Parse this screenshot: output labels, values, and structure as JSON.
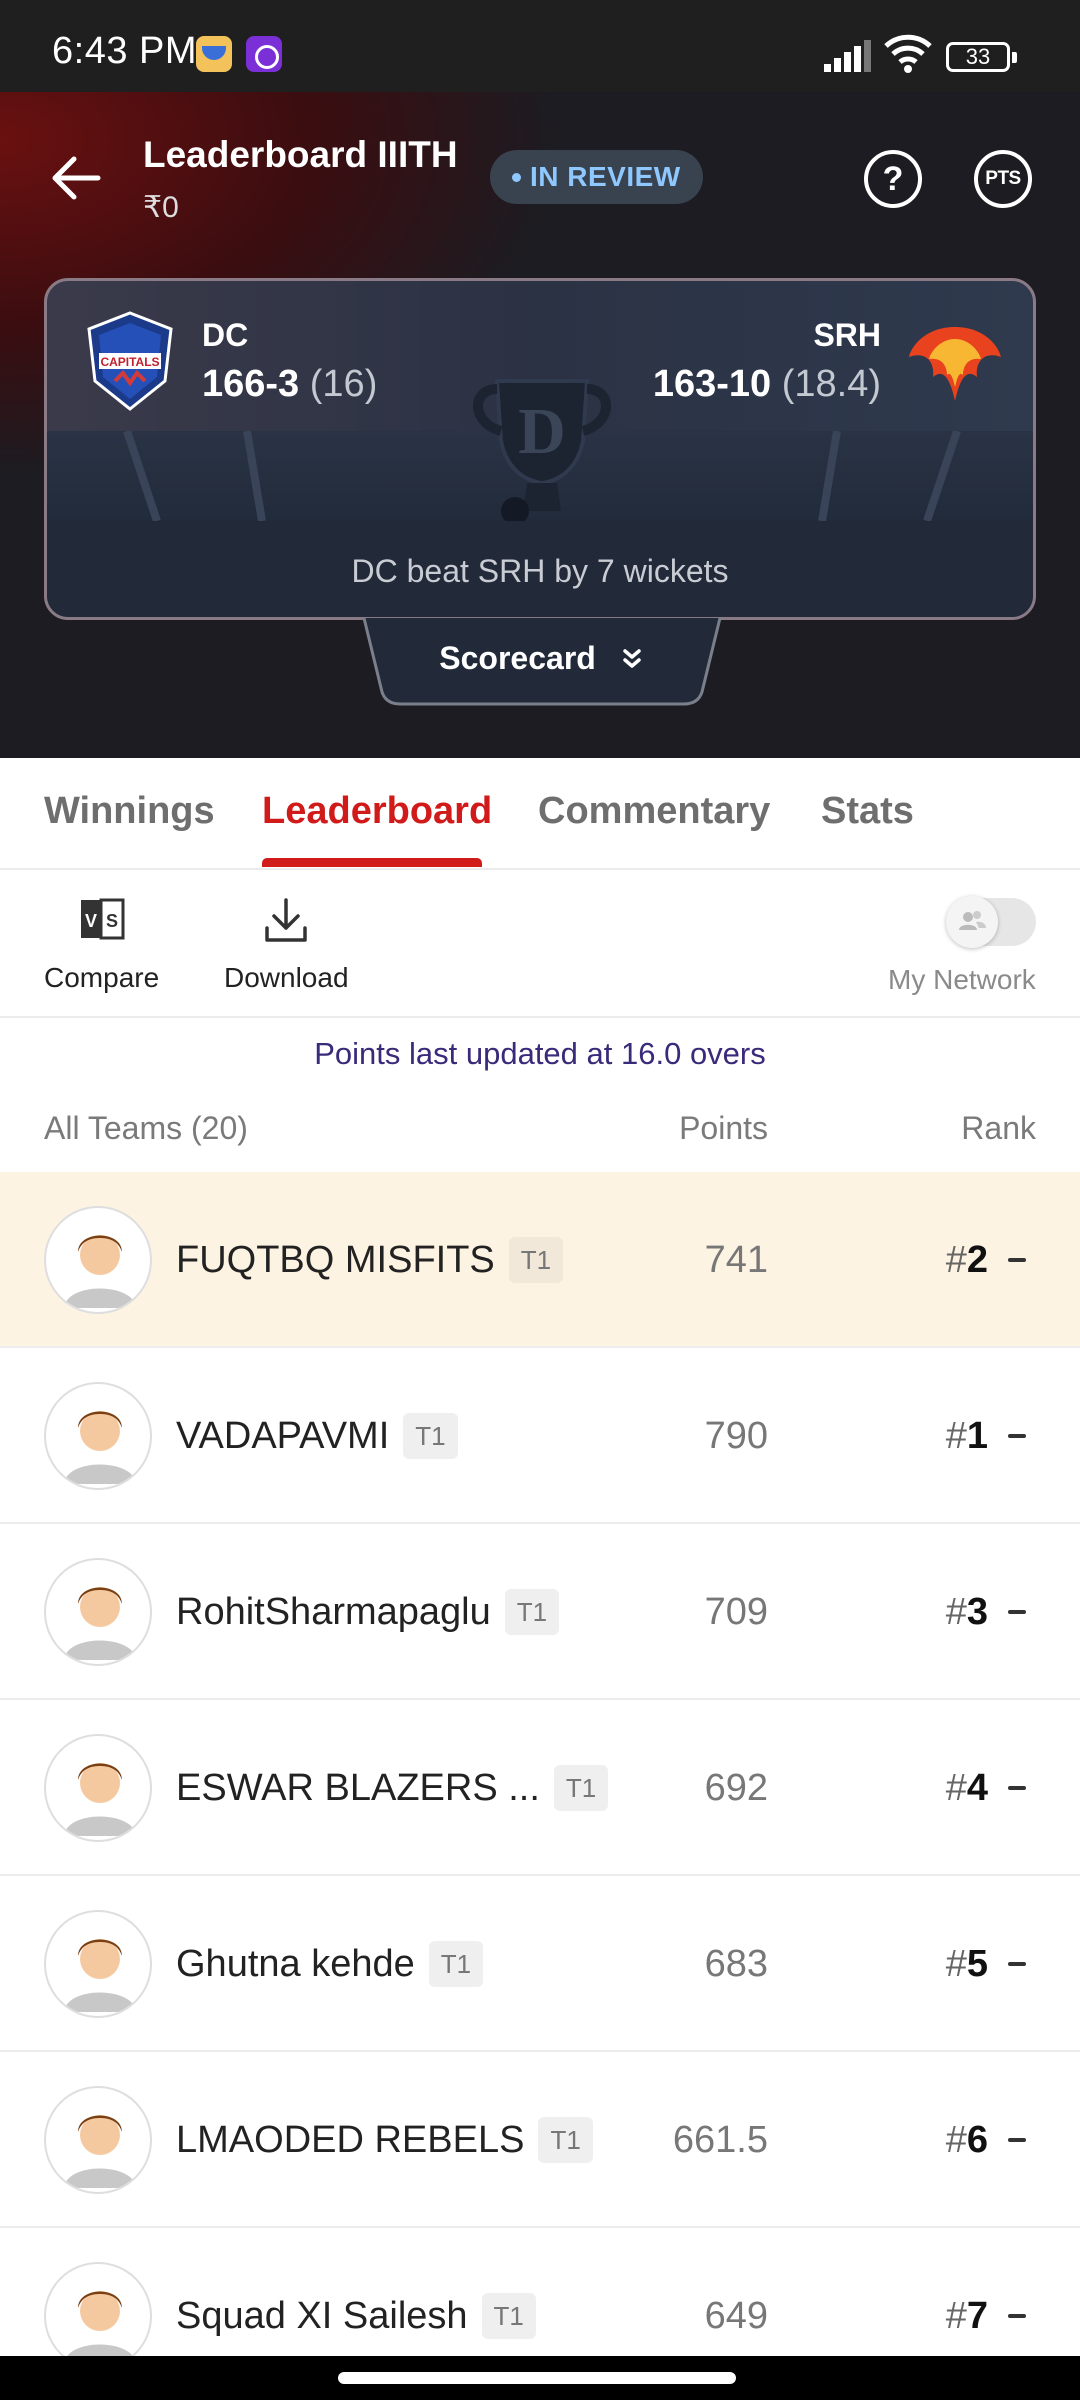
{
  "status_bar": {
    "time": "6:43 PM",
    "battery": "33"
  },
  "header": {
    "title": "Leaderboard IIITH",
    "amount": "₹0",
    "badge": "IN REVIEW",
    "help_icon": "question-circle-icon",
    "points_button": "PTS"
  },
  "match": {
    "team_left": {
      "name": "DC",
      "score": "166-3",
      "overs": "(16)",
      "logo": "delhi-capitals-logo"
    },
    "team_right": {
      "name": "SRH",
      "score": "163-10",
      "overs": "(18.4)",
      "logo": "sunrisers-logo"
    },
    "result": "DC beat SRH by 7 wickets",
    "scorecard_label": "Scorecard"
  },
  "tabs": [
    "Winnings",
    "Leaderboard",
    "Commentary",
    "Stats"
  ],
  "active_tab": "Leaderboard",
  "toolbar": {
    "compare_label": "Compare",
    "download_label": "Download",
    "network_label": "My Network",
    "network_enabled": false
  },
  "updated_note": "Points last updated at 16.0 overs",
  "list_header": {
    "teams": "All Teams (20)",
    "points": "Points",
    "rank": "Rank"
  },
  "rows": [
    {
      "name": "FUQTBQ MISFITS",
      "tag": "T1",
      "points": "741",
      "rank_hash": "#",
      "rank": "2",
      "highlight": true
    },
    {
      "name": "VADAPAVMI",
      "tag": "T1",
      "points": "790",
      "rank_hash": "#",
      "rank": "1"
    },
    {
      "name": "RohitSharmapaglu",
      "tag": "T1",
      "points": "709",
      "rank_hash": "#",
      "rank": "3"
    },
    {
      "name": "ESWAR BLAZERS ...",
      "tag": "T1",
      "points": "692",
      "rank_hash": "#",
      "rank": "4"
    },
    {
      "name": "Ghutna kehde",
      "tag": "T1",
      "points": "683",
      "rank_hash": "#",
      "rank": "5"
    },
    {
      "name": "LMAODED REBELS",
      "tag": "T1",
      "points": "661.5",
      "rank_hash": "#",
      "rank": "6"
    },
    {
      "name": "Squad XI Sailesh",
      "tag": "T1",
      "points": "649",
      "rank_hash": "#",
      "rank": "7"
    }
  ],
  "colors": {
    "accent": "#d11a1a",
    "highlight_row": "#fdf3e3",
    "badge_text": "#8fc8ff"
  }
}
